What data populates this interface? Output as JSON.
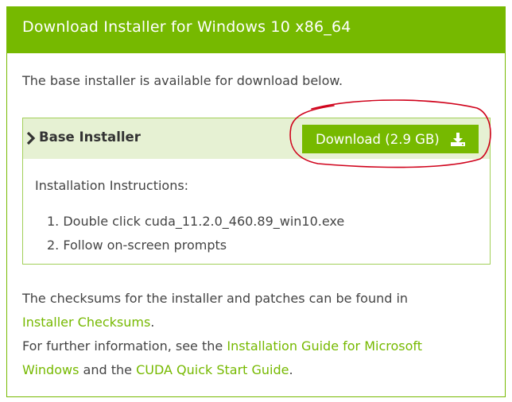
{
  "panel": {
    "title": "Download Installer for Windows 10 x86_64",
    "intro": "The base installer is available for download below."
  },
  "installer": {
    "label": "Base Installer",
    "download_label": "Download (2.9 GB)",
    "instructions_title": "Installation Instructions:",
    "steps": [
      "1. Double click cuda_11.2.0_460.89_win10.exe",
      "2. Follow on-screen prompts"
    ]
  },
  "footer": {
    "checksums_text": "The checksums for the installer and patches can be found in",
    "checksums_link": "Installer Checksums",
    "period1": ".",
    "further_text": "For further information, see the",
    "guide_link_part1": "Installation Guide for Microsoft",
    "guide_link_part2": "Windows",
    "and_the": "and the",
    "quickstart_link": "CUDA Quick Start Guide",
    "period2": "."
  },
  "colors": {
    "brand_green": "#76b900",
    "header_row_bg": "#e6f1d3",
    "annotation_red": "#d0021b"
  },
  "icons": {
    "chevron": "chevron-right-icon",
    "download": "download-icon"
  }
}
